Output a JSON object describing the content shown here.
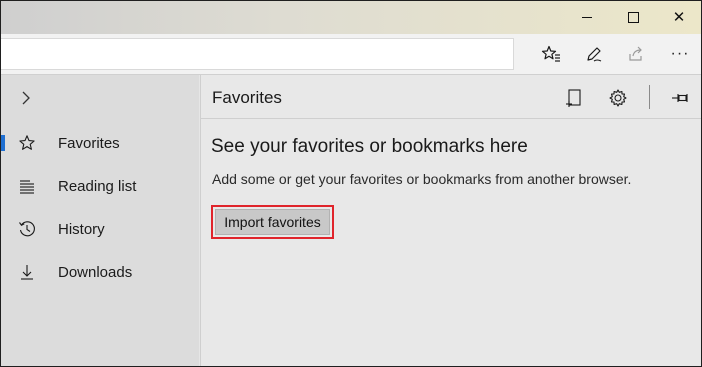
{
  "window": {
    "minimize_glyph": "minimize-icon",
    "maximize_glyph": "maximize-icon",
    "close_glyph": "✕"
  },
  "toolbar": {
    "address_value": "",
    "icons": [
      "favorites-star-icon",
      "pen-icon",
      "share-icon",
      "more-icon"
    ],
    "more_label": "···"
  },
  "nav": {
    "items": [
      {
        "label": "Favorites",
        "icon": "star-icon",
        "selected": true
      },
      {
        "label": "Reading list",
        "icon": "reading-list-icon",
        "selected": false
      },
      {
        "label": "History",
        "icon": "history-icon",
        "selected": false
      },
      {
        "label": "Downloads",
        "icon": "download-icon",
        "selected": false
      }
    ]
  },
  "hub": {
    "title": "Favorites",
    "empty_heading": "See your favorites or bookmarks here",
    "empty_sub": "Add some or get your favorites or bookmarks from another browser.",
    "import_button": "Import favorites"
  },
  "colors": {
    "accent": "#1f6fd1",
    "highlight_border": "#e0242b",
    "nav_background": "#dcdcdc",
    "hub_background": "#e8e8e8"
  }
}
